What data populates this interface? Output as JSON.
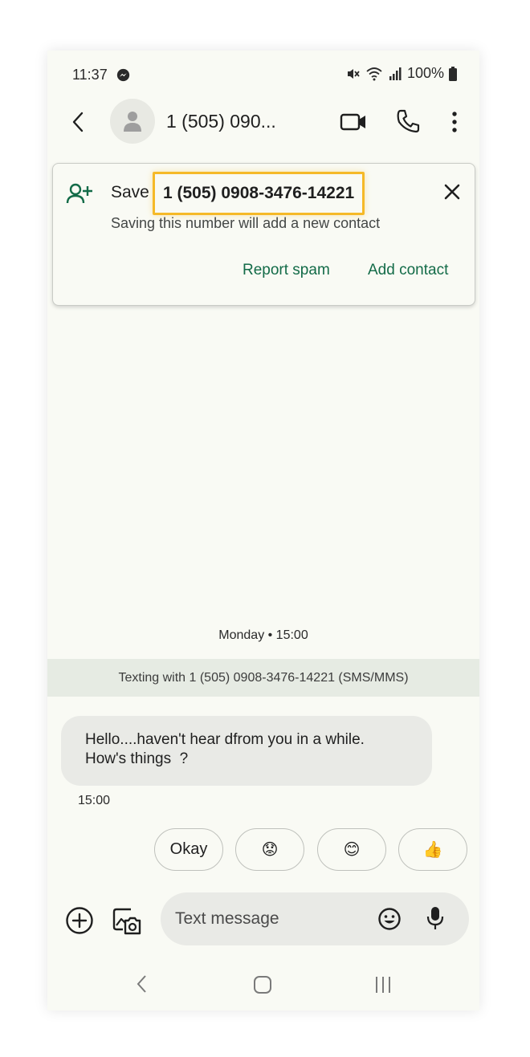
{
  "status_bar": {
    "time": "11:37",
    "battery": "100%"
  },
  "header": {
    "contact": "1 (505) 090...",
    "avatar": "person-icon"
  },
  "save_card": {
    "save_label": "Save",
    "number": "1 (505) 0908-3476-14221",
    "subtitle": "Saving this number will add a new contact",
    "report_spam": "Report spam",
    "add_contact": "Add contact",
    "highlight_color": "#f5b928",
    "action_color": "#136b48"
  },
  "conversation": {
    "date_label": "Monday • 15:00",
    "info_banner": "Texting with 1 (505) 0908-3476-14221 (SMS/MMS)",
    "message": "Hello....haven't hear dfrom you in a while.\nHow's things  ?",
    "message_time": "15:00"
  },
  "smart_replies": [
    {
      "label": "Okay"
    },
    {
      "label": "😟"
    },
    {
      "label": "😊"
    },
    {
      "label": "👍"
    }
  ],
  "compose": {
    "placeholder": "Text message"
  }
}
